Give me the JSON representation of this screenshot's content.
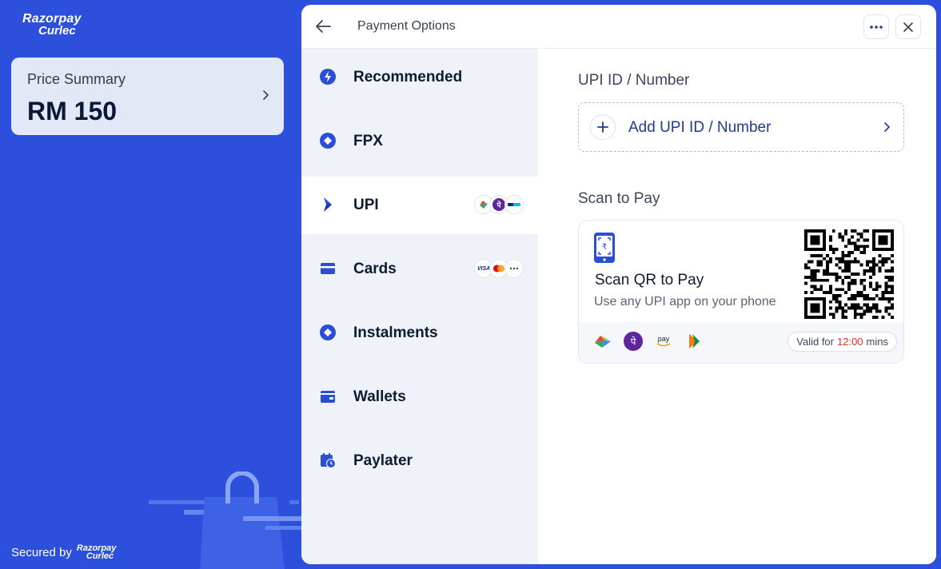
{
  "brand": {
    "line1": "Razorpay",
    "line2": "Curlec"
  },
  "summary": {
    "label": "Price Summary",
    "amount": "RM 150"
  },
  "footer": {
    "secured": "Secured by",
    "logo_line1": "Razorpay",
    "logo_line2": "Curlec"
  },
  "header": {
    "title": "Payment Options"
  },
  "methods": [
    {
      "label": "Recommended",
      "icon": "lightning-icon"
    },
    {
      "label": "FPX",
      "icon": "diamond-icon"
    },
    {
      "label": "UPI",
      "icon": "upi-icon",
      "badges": [
        "gpay",
        "phonepe",
        "paytm"
      ]
    },
    {
      "label": "Cards",
      "icon": "card-icon",
      "badges": [
        "VISA",
        "mastercard",
        "more"
      ]
    },
    {
      "label": "Instalments",
      "icon": "diamond-icon"
    },
    {
      "label": "Wallets",
      "icon": "wallet-icon"
    },
    {
      "label": "Paylater",
      "icon": "calendar-clock-icon"
    }
  ],
  "upi": {
    "section_title": "UPI ID / Number",
    "add_label": "Add UPI ID / Number",
    "scan_section_title": "Scan to Pay",
    "scan_title": "Scan QR to Pay",
    "scan_subtitle": "Use any UPI app on your phone",
    "valid_prefix": "Valid for",
    "valid_time": "12:00",
    "valid_suffix": "mins",
    "apps": [
      "gpay",
      "phonepe",
      "amazon-pay",
      "bhim"
    ],
    "amazon_pay_text": "pay"
  },
  "badges": {
    "visa": "VISA",
    "paytm": "Paytm"
  },
  "colors": {
    "brand_blue": "#2c50dc",
    "accent": "#2a4fd6",
    "timer": "#d4312e"
  }
}
